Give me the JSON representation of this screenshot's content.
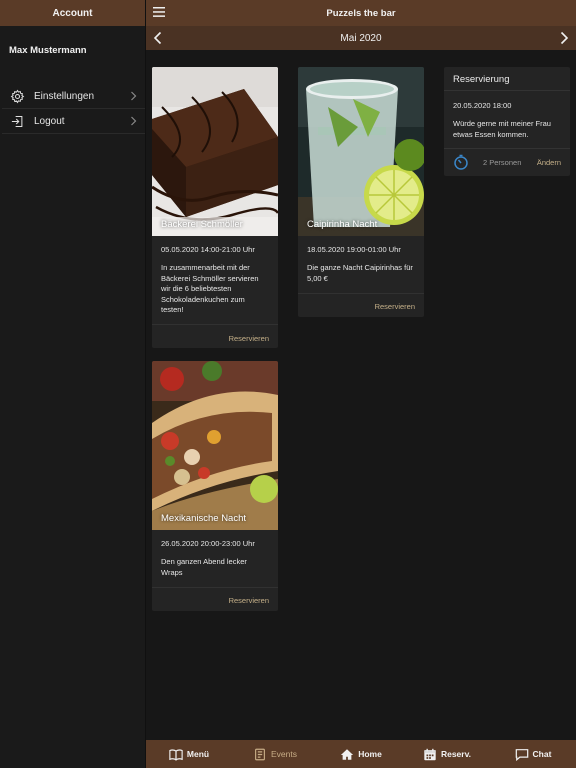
{
  "sidebar": {
    "title": "Account",
    "user_name": "Max Mustermann",
    "items": [
      {
        "label": "Einstellungen",
        "icon": "gear-icon"
      },
      {
        "label": "Logout",
        "icon": "logout-icon"
      }
    ]
  },
  "header": {
    "title": "Puzzels the bar",
    "month": "Mai 2020"
  },
  "events": [
    {
      "title": "Bäckerei Schmöller",
      "date": "05.05.2020 14:00-21:00 Uhr",
      "description": "In zusammenarbeit mit der Bäckerei Schmöller servieren wir die 6 beliebtesten Schokoladenkuchen zum testen!",
      "action": "Reservieren"
    },
    {
      "title": "Caipirinha Nacht",
      "date": "18.05.2020 19:00-01:00 Uhr",
      "description": "Die ganze Nacht Caipirinhas für 5,00 €",
      "action": "Reservieren"
    },
    {
      "title": "Mexikanische Nacht",
      "date": "26.05.2020 20:00-23:00 Uhr",
      "description": "Den ganzen Abend lecker Wraps",
      "action": "Reservieren"
    }
  ],
  "reservation": {
    "heading": "Reservierung",
    "datetime": "20.05.2020 18:00",
    "message": "Würde gerne mit meiner Frau etwas Essen kommen.",
    "persons": "2 Personen",
    "action": "Ändern"
  },
  "tabs": [
    {
      "label": "Menü",
      "icon": "book-icon"
    },
    {
      "label": "Events",
      "icon": "document-icon",
      "active": true
    },
    {
      "label": "Home",
      "icon": "home-icon"
    },
    {
      "label": "Reserv.",
      "icon": "calendar-icon"
    },
    {
      "label": "Chat",
      "icon": "chat-icon"
    }
  ],
  "colors": {
    "brand_brown": "#5a3b27",
    "accent_gold": "#c5b089",
    "background": "#171717",
    "card": "#242424",
    "timer_blue": "#3a86c8"
  }
}
